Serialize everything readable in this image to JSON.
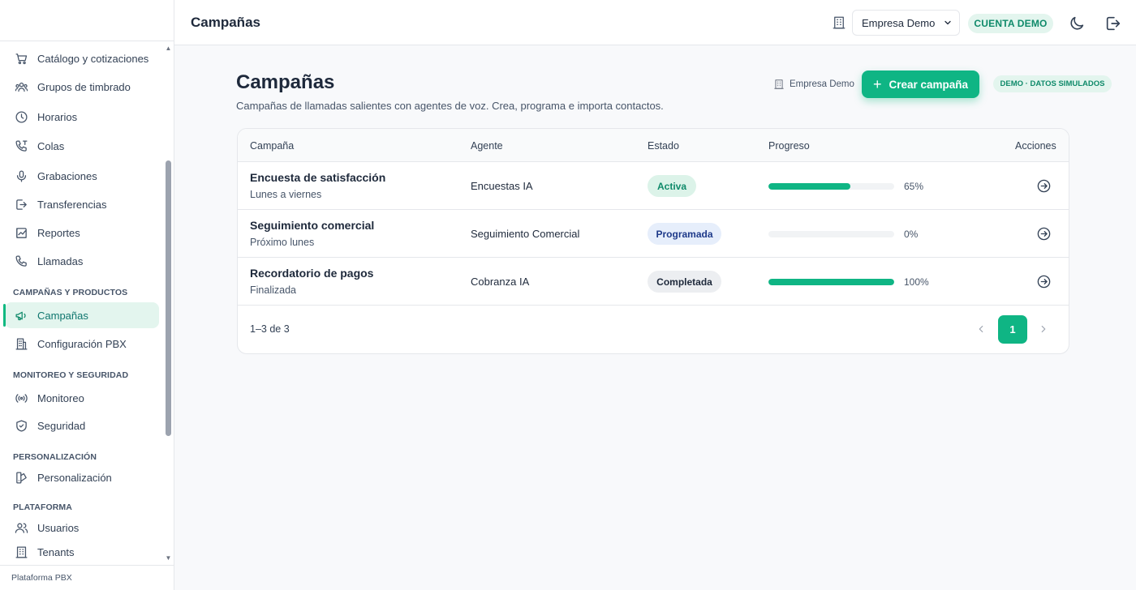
{
  "sidebar": {
    "items": [
      {
        "label": "Catálogo y cotizaciones",
        "icon": "cart-icon"
      },
      {
        "label": "Grupos de timbrado",
        "icon": "users-group-icon"
      },
      {
        "label": "Horarios",
        "icon": "clock-icon"
      },
      {
        "label": "Colas",
        "icon": "phone-queue-icon"
      },
      {
        "label": "Grabaciones",
        "icon": "microphone-icon"
      },
      {
        "label": "Transferencias",
        "icon": "transfer-icon"
      },
      {
        "label": "Reportes",
        "icon": "chart-icon"
      },
      {
        "label": "Llamadas",
        "icon": "phone-icon"
      }
    ],
    "sections": [
      {
        "title": "CAMPAÑAS Y PRODUCTOS",
        "items": [
          {
            "label": "Campañas",
            "icon": "megaphone-icon",
            "active": true
          },
          {
            "label": "Configuración PBX",
            "icon": "building-icon"
          }
        ]
      },
      {
        "title": "MONITOREO Y SEGURIDAD",
        "items": [
          {
            "label": "Monitoreo",
            "icon": "broadcast-icon"
          },
          {
            "label": "Seguridad",
            "icon": "shield-icon"
          }
        ]
      },
      {
        "title": "PERSONALIZACIÓN",
        "items": [
          {
            "label": "Personalización",
            "icon": "palette-icon"
          }
        ]
      },
      {
        "title": "PLATAFORMA",
        "items": [
          {
            "label": "Usuarios",
            "icon": "users-icon"
          },
          {
            "label": "Tenants",
            "icon": "building-icon"
          }
        ]
      }
    ],
    "footer": "Plataforma PBX"
  },
  "header": {
    "title": "Campañas",
    "company_select": "Empresa Demo",
    "account_badge": "CUENTA DEMO"
  },
  "main": {
    "title": "Campañas",
    "subtitle": "Campañas de llamadas salientes con agentes de voz. Crea, programa e importa contactos.",
    "tenant_label": "Empresa Demo",
    "create_button": "Crear campaña",
    "demo_badge": "DEMO · DATOS SIMULADOS",
    "table": {
      "columns": [
        "Campaña",
        "Agente",
        "Estado",
        "Progreso",
        "Acciones"
      ],
      "rows": [
        {
          "name": "Encuesta de satisfacción",
          "schedule": "Lunes a viernes",
          "agent": "Encuestas IA",
          "status": "Activa",
          "status_kind": "active",
          "progress": 65,
          "progress_label": "65%"
        },
        {
          "name": "Seguimiento comercial",
          "schedule": "Próximo lunes",
          "agent": "Seguimiento Comercial",
          "status": "Programada",
          "status_kind": "scheduled",
          "progress": 0,
          "progress_label": "0%"
        },
        {
          "name": "Recordatorio de pagos",
          "schedule": "Finalizada",
          "agent": "Cobranza IA",
          "status": "Completada",
          "status_kind": "completed",
          "progress": 100,
          "progress_label": "100%"
        }
      ],
      "footer_count": "1–3 de 3",
      "current_page": "1"
    }
  },
  "colors": {
    "accent": "#0fb584",
    "accent_soft": "#e3f5ee",
    "scheduled_bg": "#e6eefb",
    "completed_bg": "#eceef1"
  }
}
